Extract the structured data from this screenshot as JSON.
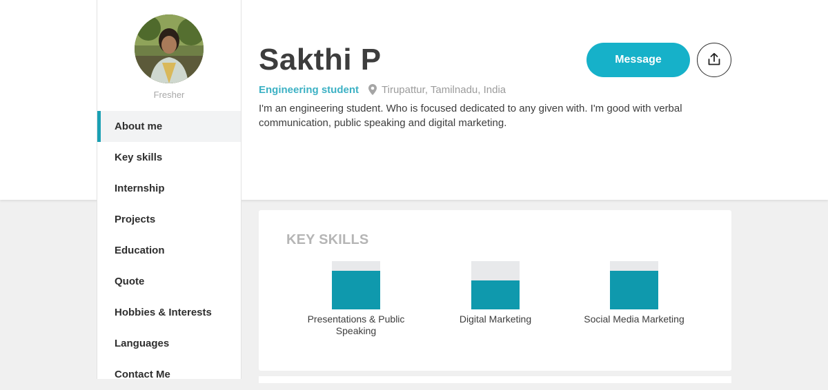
{
  "profile": {
    "name": "Sakthi P",
    "role": "Fresher",
    "headline": "Engineering student",
    "location": "Tirupattur, Tamilnadu, India",
    "bio": "I'm an engineering student. Who is focused dedicated to any given with. I'm good with verbal communication, public speaking and digital marketing."
  },
  "actions": {
    "message_label": "Message",
    "share_icon": "share-upload-icon"
  },
  "sidebar": {
    "items": [
      {
        "label": "About me",
        "active": true
      },
      {
        "label": "Key skills"
      },
      {
        "label": "Internship"
      },
      {
        "label": "Projects"
      },
      {
        "label": "Education"
      },
      {
        "label": "Quote"
      },
      {
        "label": "Hobbies & Interests"
      },
      {
        "label": "Languages"
      },
      {
        "label": "Contact Me"
      }
    ]
  },
  "key_skills": {
    "title": "KEY SKILLS",
    "skills": [
      {
        "label": "Presentations & Public Speaking",
        "level": 0.8
      },
      {
        "label": "Digital Marketing",
        "level": 0.6
      },
      {
        "label": "Social Media Marketing",
        "level": 0.8
      }
    ]
  },
  "colors": {
    "accent": "#16b1c9",
    "skill_fill": "#0f99ad",
    "headline": "#3cb1c4"
  }
}
